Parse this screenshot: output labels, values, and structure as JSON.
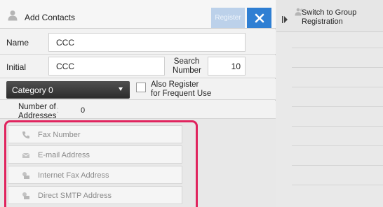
{
  "header": {
    "title": "Add Contacts",
    "register_label": "Register",
    "close_glyph": "✕"
  },
  "form": {
    "name_label": "Name",
    "name_value": "CCC",
    "initial_label": "Initial",
    "initial_value": "CCC",
    "search_number_label_line1": "Search",
    "search_number_label_line2": "Number",
    "search_number_value": "10",
    "category_value": "Category 0",
    "frequent_line1": "Also Register",
    "frequent_line2": "for Frequent Use",
    "num_addresses_line1": "Number of",
    "num_addresses_line2": "Addresses",
    "num_addresses_value": "0"
  },
  "addresses": [
    {
      "label": "Fax Number",
      "icon": "phone-icon"
    },
    {
      "label": "E-mail Address",
      "icon": "envelope-icon"
    },
    {
      "label": "Internet Fax Address",
      "icon": "internet-fax-icon"
    },
    {
      "label": "Direct SMTP Address",
      "icon": "direct-smtp-icon"
    }
  ],
  "side_panel": {
    "switch_line1": "Switch to Group",
    "switch_line2": "Registration"
  },
  "colors": {
    "accent": "#2f7fd3",
    "register_disabled": "#bcd1ea",
    "highlight": "#e0245e"
  }
}
